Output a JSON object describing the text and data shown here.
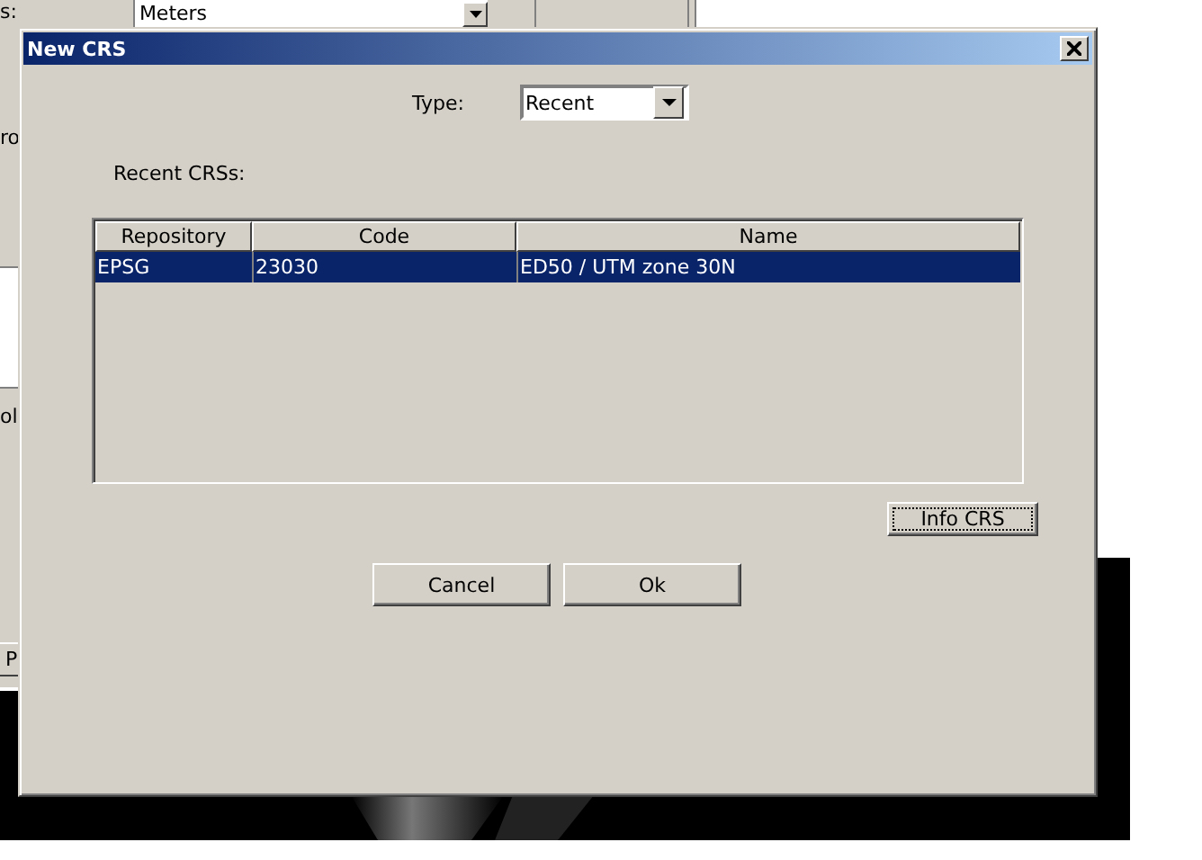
{
  "parent_window": {
    "units_label": "s:",
    "units_value": "Meters",
    "label_2": "ro",
    "label_3": "ol",
    "button": "P"
  },
  "dialog": {
    "title": "New CRS",
    "type_label": "Type:",
    "type_value": "Recent",
    "list_label": "Recent CRSs:",
    "table": {
      "columns": [
        "Repository",
        "Code",
        "Name"
      ],
      "rows": [
        {
          "cells": [
            "EPSG",
            "23030",
            "ED50 / UTM zone 30N"
          ],
          "selected": true
        }
      ]
    },
    "info_button": {
      "label": "Info CRS",
      "focused": true
    },
    "buttons": [
      {
        "label": "Cancel",
        "focused": false
      },
      {
        "label": "Ok",
        "focused": false
      }
    ]
  }
}
